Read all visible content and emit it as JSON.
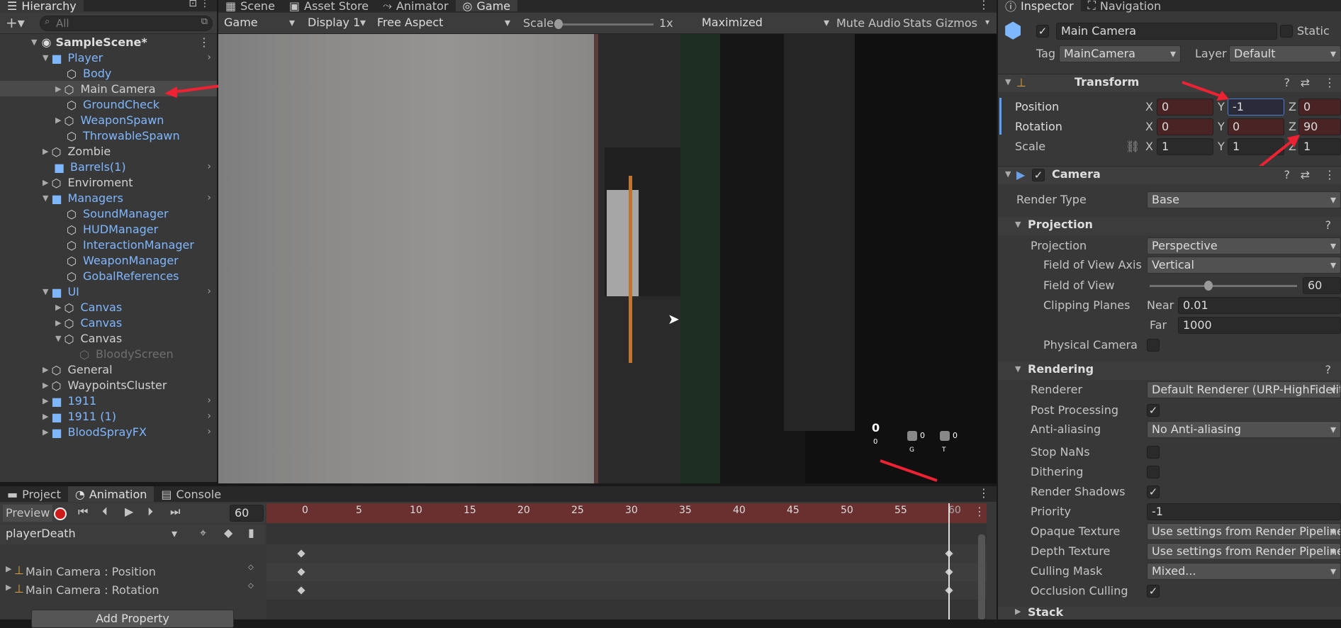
{
  "hierarchy": {
    "tab_label": "Hierarchy",
    "search_placeholder": "All",
    "items": [
      {
        "label": "SampleScene*"
      },
      {
        "label": "Player"
      },
      {
        "label": "Body"
      },
      {
        "label": "Main Camera"
      },
      {
        "label": "GroundCheck"
      },
      {
        "label": "WeaponSpawn"
      },
      {
        "label": "ThrowableSpawn"
      },
      {
        "label": "Zombie"
      },
      {
        "label": "Barrels(1)"
      },
      {
        "label": "Enviroment"
      },
      {
        "label": "Managers"
      },
      {
        "label": "SoundManager"
      },
      {
        "label": "HUDManager"
      },
      {
        "label": "InteractionManager"
      },
      {
        "label": "WeaponManager"
      },
      {
        "label": "GobalReferences"
      },
      {
        "label": "UI"
      },
      {
        "label": "Canvas"
      },
      {
        "label": "Canvas"
      },
      {
        "label": "Canvas"
      },
      {
        "label": "BloodyScreen"
      },
      {
        "label": "General"
      },
      {
        "label": "WaypointsCluster"
      },
      {
        "label": "1911"
      },
      {
        "label": "1911 (1)"
      },
      {
        "label": "BloodSprayFX"
      }
    ]
  },
  "center_tabs": {
    "scene": "Scene",
    "asset_store": "Asset Store",
    "animator": "Animator",
    "game": "Game"
  },
  "game_toolbar": {
    "view": "Game",
    "display": "Display 1",
    "aspect": "Free Aspect",
    "scale_label": "Scale",
    "scale_value": "1x",
    "maximized": "Maximized",
    "mute": "Mute Audio",
    "stats": "Stats",
    "gizmos": "Gizmos"
  },
  "bottom_tabs": {
    "project": "Project",
    "animation": "Animation",
    "console": "Console"
  },
  "animation": {
    "preview": "Preview",
    "frame": "60",
    "clip": "playerDeath",
    "ruler": [
      "0",
      "5",
      "10",
      "15",
      "20",
      "25",
      "30",
      "35",
      "40",
      "45",
      "50",
      "55",
      "60"
    ],
    "properties": [
      {
        "label": "Main Camera : Position"
      },
      {
        "label": "Main Camera : Rotation"
      }
    ],
    "add_property": "Add Property"
  },
  "inspector": {
    "tab_inspector": "Inspector",
    "tab_navigation": "Navigation",
    "object_name": "Main Camera",
    "static_label": "Static",
    "tag_label": "Tag",
    "tag_value": "MainCamera",
    "layer_label": "Layer",
    "layer_value": "Default",
    "transform": {
      "title": "Transform",
      "position_label": "Position",
      "rotation_label": "Rotation",
      "scale_label": "Scale",
      "position": {
        "x": "0",
        "y": "-1",
        "z": "0"
      },
      "rotation": {
        "x": "0",
        "y": "0",
        "z": "90"
      },
      "scale": {
        "x": "1",
        "y": "1",
        "z": "1"
      },
      "axis_x": "X",
      "axis_y": "Y",
      "axis_z": "Z"
    },
    "camera": {
      "title": "Camera",
      "render_type_label": "Render Type",
      "render_type": "Base",
      "projection_section": "Projection",
      "projection_label": "Projection",
      "projection": "Perspective",
      "fov_axis_label": "Field of View Axis",
      "fov_axis": "Vertical",
      "fov_label": "Field of View",
      "fov": "60",
      "fov_level": 0.4,
      "clipping_label": "Clipping Planes",
      "near_label": "Near",
      "near": "0.01",
      "far_label": "Far",
      "far": "1000",
      "physical_label": "Physical Camera",
      "rendering_section": "Rendering",
      "renderer_label": "Renderer",
      "renderer": "Default Renderer (URP-HighFidelity",
      "post_label": "Post Processing",
      "aa_label": "Anti-aliasing",
      "aa": "No Anti-aliasing",
      "stopnans_label": "Stop NaNs",
      "dithering_label": "Dithering",
      "shadows_label": "Render Shadows",
      "priority_label": "Priority",
      "priority": "-1",
      "opaque_label": "Opaque Texture",
      "opaque": "Use settings from Render Pipeline A",
      "depth_label": "Depth Texture",
      "depth": "Use settings from Render Pipeline A",
      "culling_label": "Culling Mask",
      "culling": "Mixed...",
      "occlusion_label": "Occlusion Culling",
      "stack_section": "Stack",
      "check": "✓"
    }
  },
  "hud": {
    "ammo_main": "0",
    "ammo_sub": "0",
    "slot1_count": "0",
    "slot1_key": "G",
    "slot2_count": "0",
    "slot2_key": "T"
  }
}
